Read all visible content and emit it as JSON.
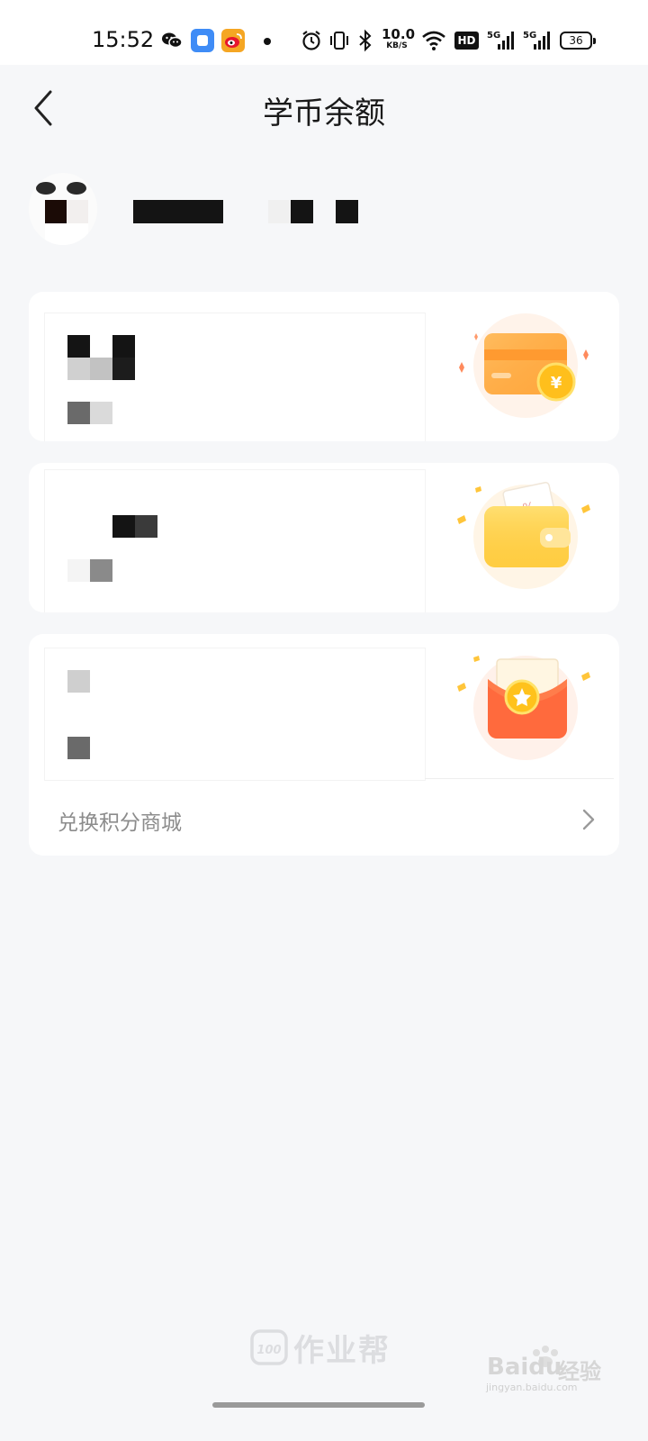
{
  "status_bar": {
    "time": "15:52",
    "net_speed_value": "10.0",
    "net_speed_unit": "KB/S",
    "hd_label": "HD",
    "signal_1": "5G",
    "signal_2": "5G",
    "battery": "36",
    "icons": [
      "wechat-icon",
      "app-icon",
      "weibo-icon",
      "dot-icon",
      "alarm-icon",
      "vibrate-icon",
      "bluetooth-icon",
      "wifi-icon",
      "hd-icon",
      "signal-icon",
      "signal-icon",
      "battery-icon"
    ]
  },
  "header": {
    "title": "学币余额",
    "back_icon": "chevron-left-icon"
  },
  "user": {
    "avatar_icon": "avatar-blurred",
    "name_blurred": true
  },
  "cards": [
    {
      "id": "coin-balance",
      "icon": "bank-card-coin-icon",
      "content_blurred": true
    },
    {
      "id": "wallet",
      "icon": "wallet-icon",
      "content_blurred": true
    },
    {
      "id": "red-packet",
      "icon": "red-envelope-icon",
      "content_blurred": true
    }
  ],
  "mall_link": {
    "label": "兑换积分商城",
    "icon": "chevron-right-icon"
  },
  "footer": {
    "brand": "作业帮",
    "watermark_main": "Baidu",
    "watermark_cn": "经验",
    "watermark_url": "jingyan.baidu.com"
  },
  "colors": {
    "background": "#f6f7f9",
    "card": "#ffffff",
    "orange": "#ff9a3c",
    "yellow": "#ffc94a",
    "red": "#ff6a3d",
    "muted_text": "#8c8c8c"
  }
}
